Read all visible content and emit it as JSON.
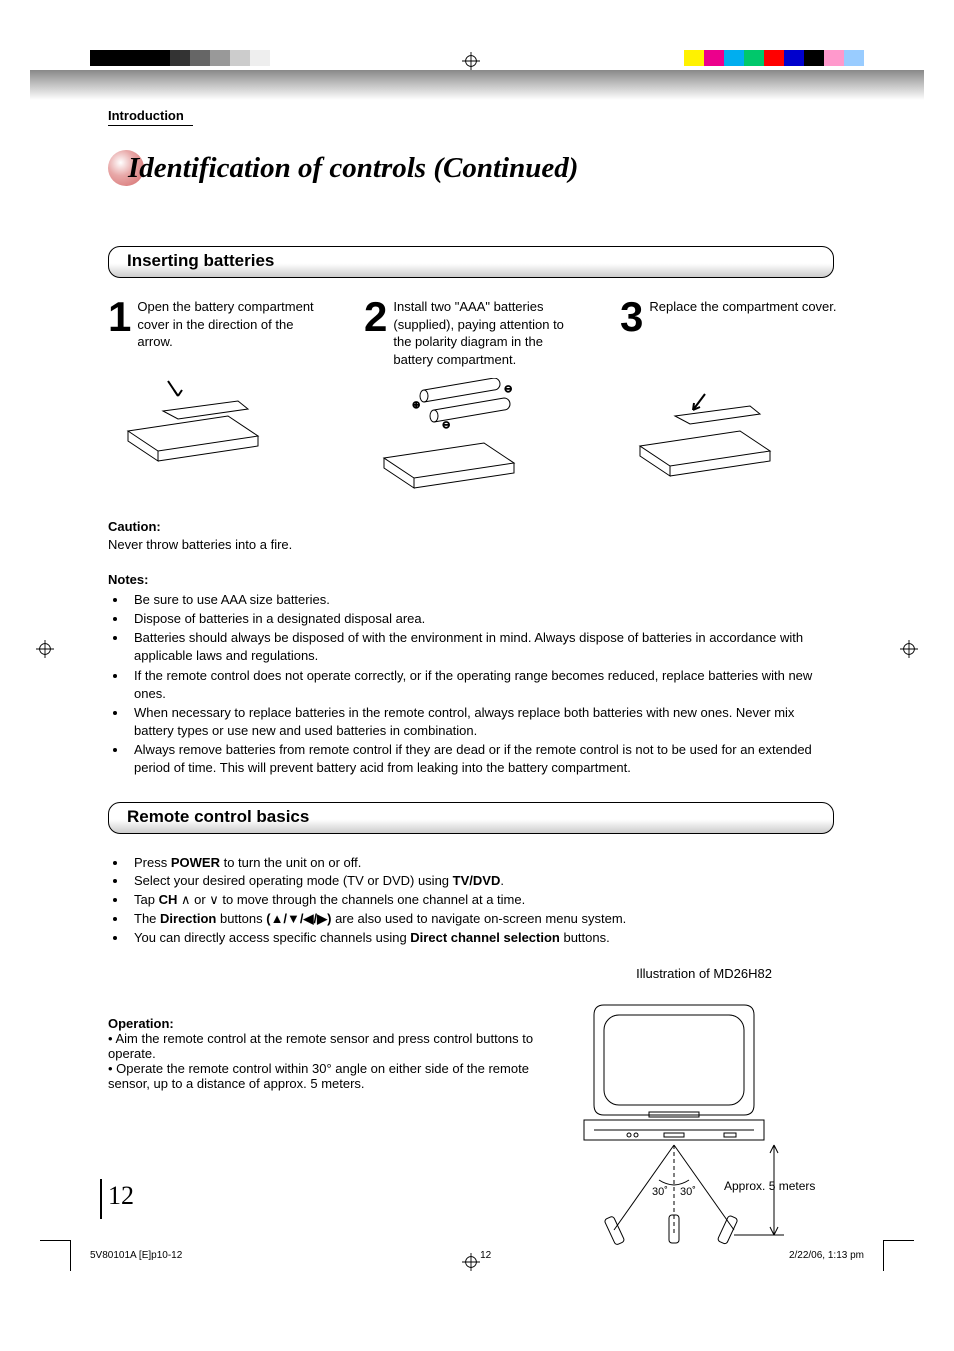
{
  "header": {
    "section_label": "Introduction",
    "title": "Identification of controls (Continued)"
  },
  "inserting_batteries": {
    "heading": "Inserting batteries",
    "steps": [
      {
        "num": "1",
        "text": "Open the battery compartment cover in the direction of the arrow."
      },
      {
        "num": "2",
        "text": "Install two \"AAA\" batteries (supplied), paying attention to the polarity diagram in the battery compartment."
      },
      {
        "num": "3",
        "text": "Replace the compartment cover."
      }
    ],
    "caution_label": "Caution:",
    "caution_text": "Never throw batteries into a fire.",
    "notes_label": "Notes:",
    "notes": [
      "Be sure to use AAA size batteries.",
      "Dispose of batteries in a designated disposal area.",
      "Batteries should always be disposed of with the environment in mind. Always dispose of batteries in accordance with applicable laws and regulations.",
      "If the remote control does not operate correctly, or if the operating range becomes reduced, replace batteries with new ones.",
      "When necessary to replace batteries in the remote control, always replace both batteries with new ones. Never mix battery types or use new and used batteries in combination.",
      "Always remove batteries from remote control if they are dead or if the remote control is not to be used for an extended period of time. This will prevent battery acid from leaking into the battery compartment."
    ]
  },
  "remote_basics": {
    "heading": "Remote control basics",
    "items": [
      {
        "pre": "Press ",
        "bold": "POWER",
        "post": " to turn the unit on or off."
      },
      {
        "pre": "Select your desired operating mode (TV or DVD) using ",
        "bold": "TV/DVD",
        "post": "."
      },
      {
        "pre": "Tap ",
        "bold": "CH",
        "post_sym": " ∧ or ∨ to move through the channels one channel at a time."
      },
      {
        "pre": "The ",
        "bold": "Direction",
        "post": " buttons ",
        "sym": "(▲/▼/◀/▶)",
        "post2": " are also used to navigate on-screen menu system."
      },
      {
        "pre": "You can directly access specific channels using ",
        "bold": "Direct channel selection",
        "post": " buttons."
      }
    ],
    "illustration_caption": "Illustration of MD26H82",
    "operation_label": "Operation:",
    "operation_items": [
      "Aim the remote control at the remote sensor and press control buttons to operate.",
      "Operate the remote control within 30° angle on either side of the remote sensor, up to a distance of approx. 5 meters."
    ],
    "diagram": {
      "angle_left": "30˚",
      "angle_right": "30˚",
      "distance": "Approx. 5 meters"
    }
  },
  "page_number": "12",
  "footer": {
    "file": "5V80101A [E]p10-12",
    "page": "12",
    "date": "2/22/06, 1:13 pm"
  }
}
